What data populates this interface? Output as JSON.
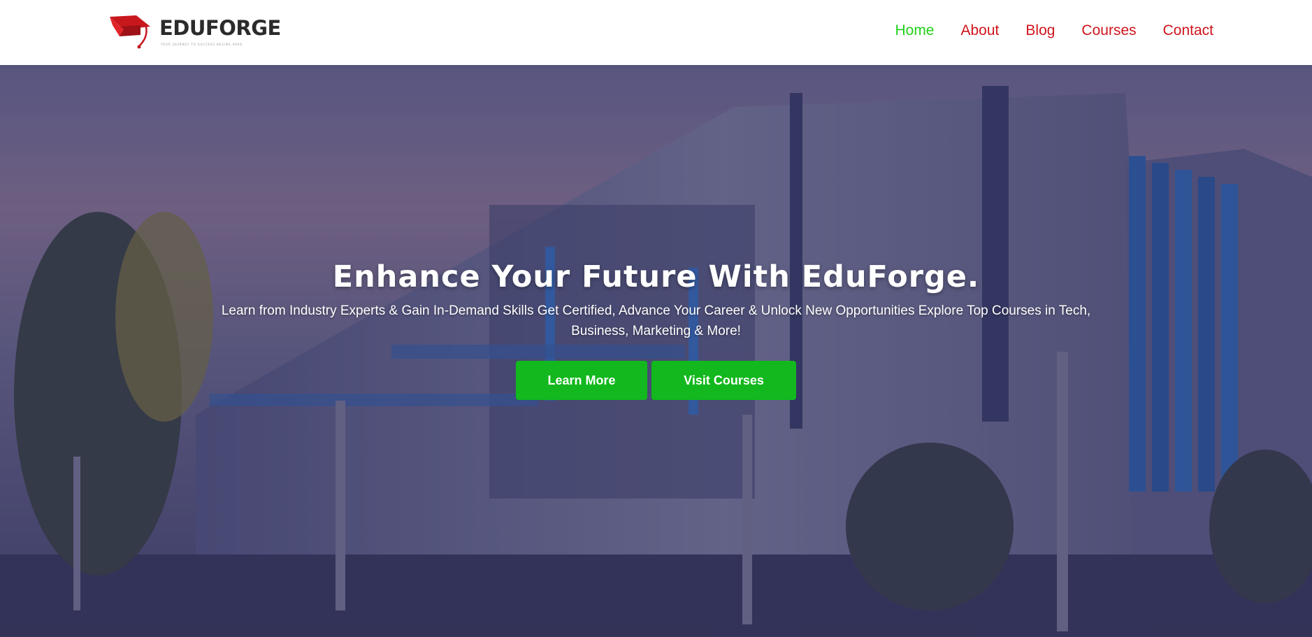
{
  "brand": {
    "name": "EDUFORGE",
    "tagline": "YOUR JOURNEY TO SUCCESS BEGINS HERE",
    "icon": "graduation-cap-icon",
    "colors": {
      "icon": "#c8181e",
      "wordmark": "#2b2b2b"
    }
  },
  "nav": {
    "items": [
      {
        "label": "Home",
        "active": true
      },
      {
        "label": "About",
        "active": false
      },
      {
        "label": "Blog",
        "active": false
      },
      {
        "label": "Courses",
        "active": false
      },
      {
        "label": "Contact",
        "active": false
      }
    ],
    "colors": {
      "default": "#d0141b",
      "active": "#21d11a"
    }
  },
  "hero": {
    "title": "Enhance Your Future With EduForge.",
    "subtitle": "Learn from Industry Experts & Gain In-Demand Skills Get Certified, Advance Your Career & Unlock New Opportunities Explore Top Courses in Tech, Business, Marketing & More!",
    "buttons": {
      "learn_more": "Learn More",
      "visit_courses": "Visit Courses"
    },
    "colors": {
      "button": "#12b81d",
      "text": "#ffffff"
    }
  }
}
